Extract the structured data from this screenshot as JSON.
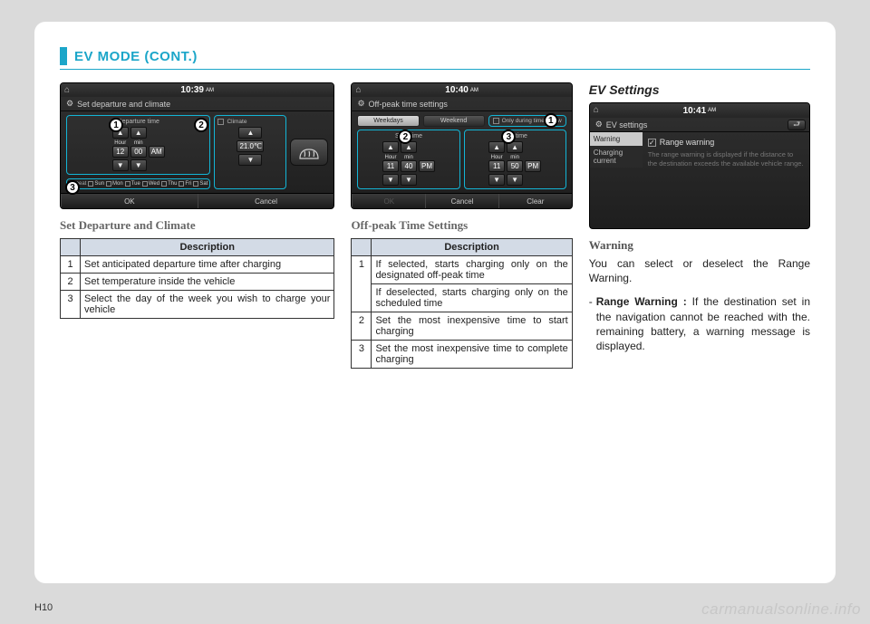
{
  "header": {
    "title": "EV MODE (CONT.)"
  },
  "page_number": "H10",
  "watermark": "carmanualsonline.info",
  "col3_section_title": "EV Settings",
  "screen1": {
    "time": "10:39",
    "ampm": "AM",
    "title": "Set departure and climate",
    "departure_label": "Departure time",
    "climate_label": "Climate",
    "hour_label": "Hour",
    "min_label": "min",
    "hour": "12",
    "min": "00",
    "ap": "AM",
    "temp": "21.0℃",
    "repeat_label": "Repeat",
    "days": [
      "Sun",
      "Mon",
      "Tue",
      "Wed",
      "Thu",
      "Fri",
      "Sat"
    ],
    "ok": "OK",
    "cancel": "Cancel"
  },
  "screen2": {
    "time": "10:40",
    "ampm": "AM",
    "title": "Off-peak time settings",
    "tab1": "Weekdays",
    "tab2": "Weekend",
    "only_label": "Only during time below",
    "start_label": "Start time",
    "end_label": "End time",
    "hour_label": "Hour",
    "min_label": "min",
    "sh": "11",
    "sm": "40",
    "sap": "PM",
    "eh": "11",
    "em": "50",
    "eap": "PM",
    "ok": "OK",
    "cancel": "Cancel",
    "clear": "Clear"
  },
  "screen3": {
    "time": "10:41",
    "ampm": "AM",
    "title": "EV settings",
    "side_warning": "Warning",
    "side_charging": "Charging current",
    "check_label": "Range warning",
    "desc": "The range warning is displayed if the distance to the destination exceeds the available vehicle range."
  },
  "caption1": "Set Departure and Climate",
  "caption2": "Off-peak Time Settings",
  "table_header": "Description",
  "table1": [
    {
      "n": "1",
      "d": "Set anticipated departure time after charging"
    },
    {
      "n": "2",
      "d": "Set temperature inside the vehicle"
    },
    {
      "n": "3",
      "d": "Select the day of the week you wish to charge your vehicle"
    }
  ],
  "table2": [
    {
      "n": "1",
      "d1": "If selected, starts charging only on the designated off-peak time",
      "d2": "If deselected, starts charging only on the scheduled time"
    },
    {
      "n": "2",
      "d": "Set the most inexpensive time to start charging"
    },
    {
      "n": "3",
      "d": "Set the most inexpensive time to complete charging"
    }
  ],
  "right": {
    "warning_title": "Warning",
    "warning_body": "You can select or deselect  the Range Warning.",
    "bullet_lead": "Range Warning :",
    "bullet_body": "If the destination set in the navigation cannot be reached with the. remaining battery, a warning message is displayed."
  },
  "callouts": {
    "c1": "1",
    "c2": "2",
    "c3": "3"
  }
}
